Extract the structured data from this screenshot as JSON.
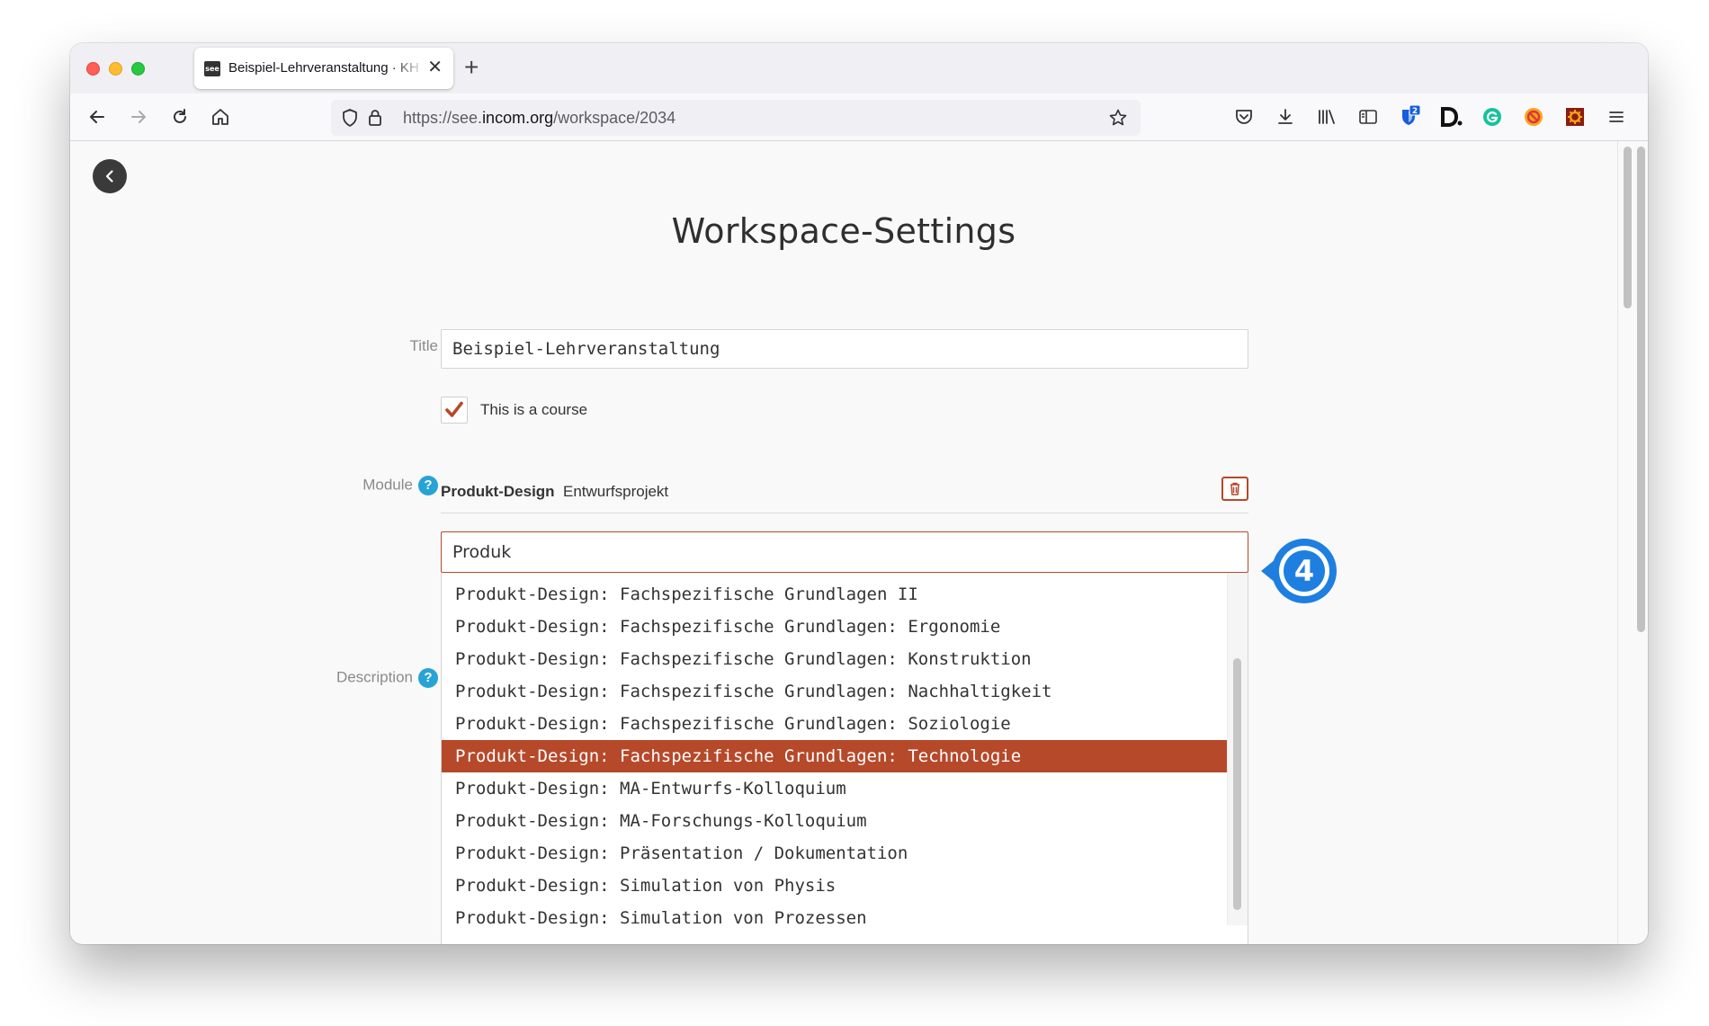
{
  "browser": {
    "tab_title": "Beispiel-Lehrveranstaltung · KH",
    "favicon_text": "see",
    "url_prefix": "https://see.",
    "url_domain": "incom.org",
    "url_path": "/workspace/2034",
    "extension_badge": "2"
  },
  "page": {
    "title": "Workspace-Settings",
    "form": {
      "title_label": "Title",
      "title_value": "Beispiel-Lehrveranstaltung",
      "course_checkbox_label": "This is a course",
      "course_checked": true,
      "module_label": "Module",
      "module_selected_category": "Produkt-Design",
      "module_selected_name": "Entwurfsprojekt",
      "module_search_value": "Produk",
      "description_label": "Description",
      "help_symbol": "?"
    },
    "dropdown": {
      "items": [
        "Produkt-Design: Fachspezifische Grundlagen II",
        "Produkt-Design: Fachspezifische Grundlagen: Ergonomie",
        "Produkt-Design: Fachspezifische Grundlagen: Konstruktion",
        "Produkt-Design: Fachspezifische Grundlagen: Nachhaltigkeit",
        "Produkt-Design: Fachspezifische Grundlagen: Soziologie",
        "Produkt-Design: Fachspezifische Grundlagen: Technologie",
        "Produkt-Design: MA-Entwurfs-Kolloquium",
        "Produkt-Design: MA-Forschungs-Kolloquium",
        "Produkt-Design: Präsentation / Dokumentation",
        "Produkt-Design: Simulation von Physis",
        "Produkt-Design: Simulation von Prozessen"
      ],
      "selected_index": 5
    },
    "callout_number": "4"
  },
  "colors": {
    "accent": "#b5492a",
    "help": "#27a3d6",
    "callout": "#1e7fe0"
  }
}
